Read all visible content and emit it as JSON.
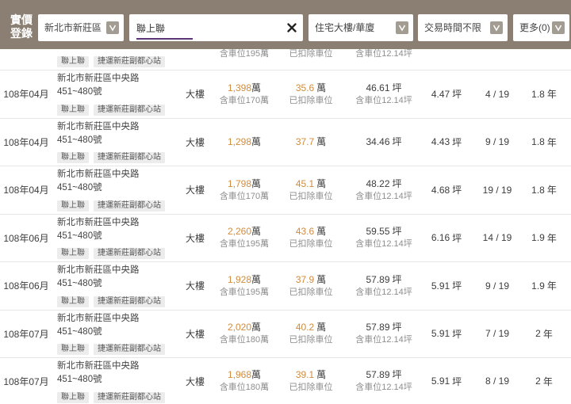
{
  "header": {
    "brand": [
      "實價",
      "登錄"
    ],
    "city_select": "新北市新莊區",
    "search": {
      "value": "聯上聯",
      "clear_icon": "close-icon"
    },
    "type_select": "住宅大樓/華廈",
    "time_select": "交易時間不限",
    "more_select": "更多(0)",
    "dropdown_icon": "chevron-down-icon"
  },
  "colors": {
    "header_bg": "#8a7f72",
    "accent": "#d08c3e",
    "search_underline": "#5b3575",
    "chevron_bg": "#a39c93"
  },
  "units": {
    "wan": "萬",
    "ping": "坪",
    "year": "年"
  },
  "partial_row": {
    "tags": [
      "聯上聯",
      "捷運新莊副都心站"
    ],
    "total_price_note": "含車位195萬",
    "unit_price_note": "已扣除車位",
    "area_note": "含車位12.14坪"
  },
  "rows": [
    {
      "date": "108年04月",
      "address": [
        "新北市新莊區中央路",
        "451~480號"
      ],
      "tags": [
        "聯上聯",
        "捷運新莊副都心站"
      ],
      "type": "大樓",
      "total_price": "1,398",
      "total_price_note": "含車位170萬",
      "unit_price": "35.6",
      "unit_price_note": "已扣除車位",
      "area": "46.61",
      "area_note": "含車位12.14坪",
      "area2": "4.47",
      "floor": "4 / 19",
      "age": "1.8"
    },
    {
      "date": "108年04月",
      "address": [
        "新北市新莊區中央路",
        "451~480號"
      ],
      "tags": [
        "聯上聯",
        "捷運新莊副都心站"
      ],
      "type": "大樓",
      "total_price": "1,298",
      "unit_price": "37.7",
      "area": "34.46",
      "area2": "4.43",
      "floor": "9 / 19",
      "age": "1.8"
    },
    {
      "date": "108年04月",
      "address": [
        "新北市新莊區中央路",
        "451~480號"
      ],
      "tags": [
        "聯上聯",
        "捷運新莊副都心站"
      ],
      "type": "大樓",
      "total_price": "1,798",
      "total_price_note": "含車位170萬",
      "unit_price": "45.1",
      "unit_price_note": "已扣除車位",
      "area": "48.22",
      "area_note": "含車位12.14坪",
      "area2": "4.68",
      "floor": "19 / 19",
      "age": "1.8"
    },
    {
      "date": "108年06月",
      "address": [
        "新北市新莊區中央路",
        "451~480號"
      ],
      "tags": [
        "聯上聯",
        "捷運新莊副都心站"
      ],
      "type": "大樓",
      "total_price": "2,260",
      "total_price_note": "含車位195萬",
      "unit_price": "43.6",
      "unit_price_note": "已扣除車位",
      "area": "59.55",
      "area_note": "含車位12.14坪",
      "area2": "6.16",
      "floor": "14 / 19",
      "age": "1.9"
    },
    {
      "date": "108年06月",
      "address": [
        "新北市新莊區中央路",
        "451~480號"
      ],
      "tags": [
        "聯上聯",
        "捷運新莊副都心站"
      ],
      "type": "大樓",
      "total_price": "1,928",
      "total_price_note": "含車位195萬",
      "unit_price": "37.9",
      "unit_price_note": "已扣除車位",
      "area": "57.89",
      "area_note": "含車位12.14坪",
      "area2": "5.91",
      "floor": "9 / 19",
      "age": "1.9"
    },
    {
      "date": "108年07月",
      "address": [
        "新北市新莊區中央路",
        "451~480號"
      ],
      "tags": [
        "聯上聯",
        "捷運新莊副都心站"
      ],
      "type": "大樓",
      "total_price": "2,020",
      "total_price_note": "含車位180萬",
      "unit_price": "40.2",
      "unit_price_note": "已扣除車位",
      "area": "57.89",
      "area_note": "含車位12.14坪",
      "area2": "5.91",
      "floor": "7 / 19",
      "age": "2"
    },
    {
      "date": "108年07月",
      "address": [
        "新北市新莊區中央路",
        "451~480號"
      ],
      "tags": [
        "聯上聯",
        "捷運新莊副都心站"
      ],
      "type": "大樓",
      "total_price": "1,968",
      "total_price_note": "含車位180萬",
      "unit_price": "39.1",
      "unit_price_note": "已扣除車位",
      "area": "57.89",
      "area_note": "含車位12.14坪",
      "area2": "5.91",
      "floor": "8 / 19",
      "age": "2"
    }
  ]
}
